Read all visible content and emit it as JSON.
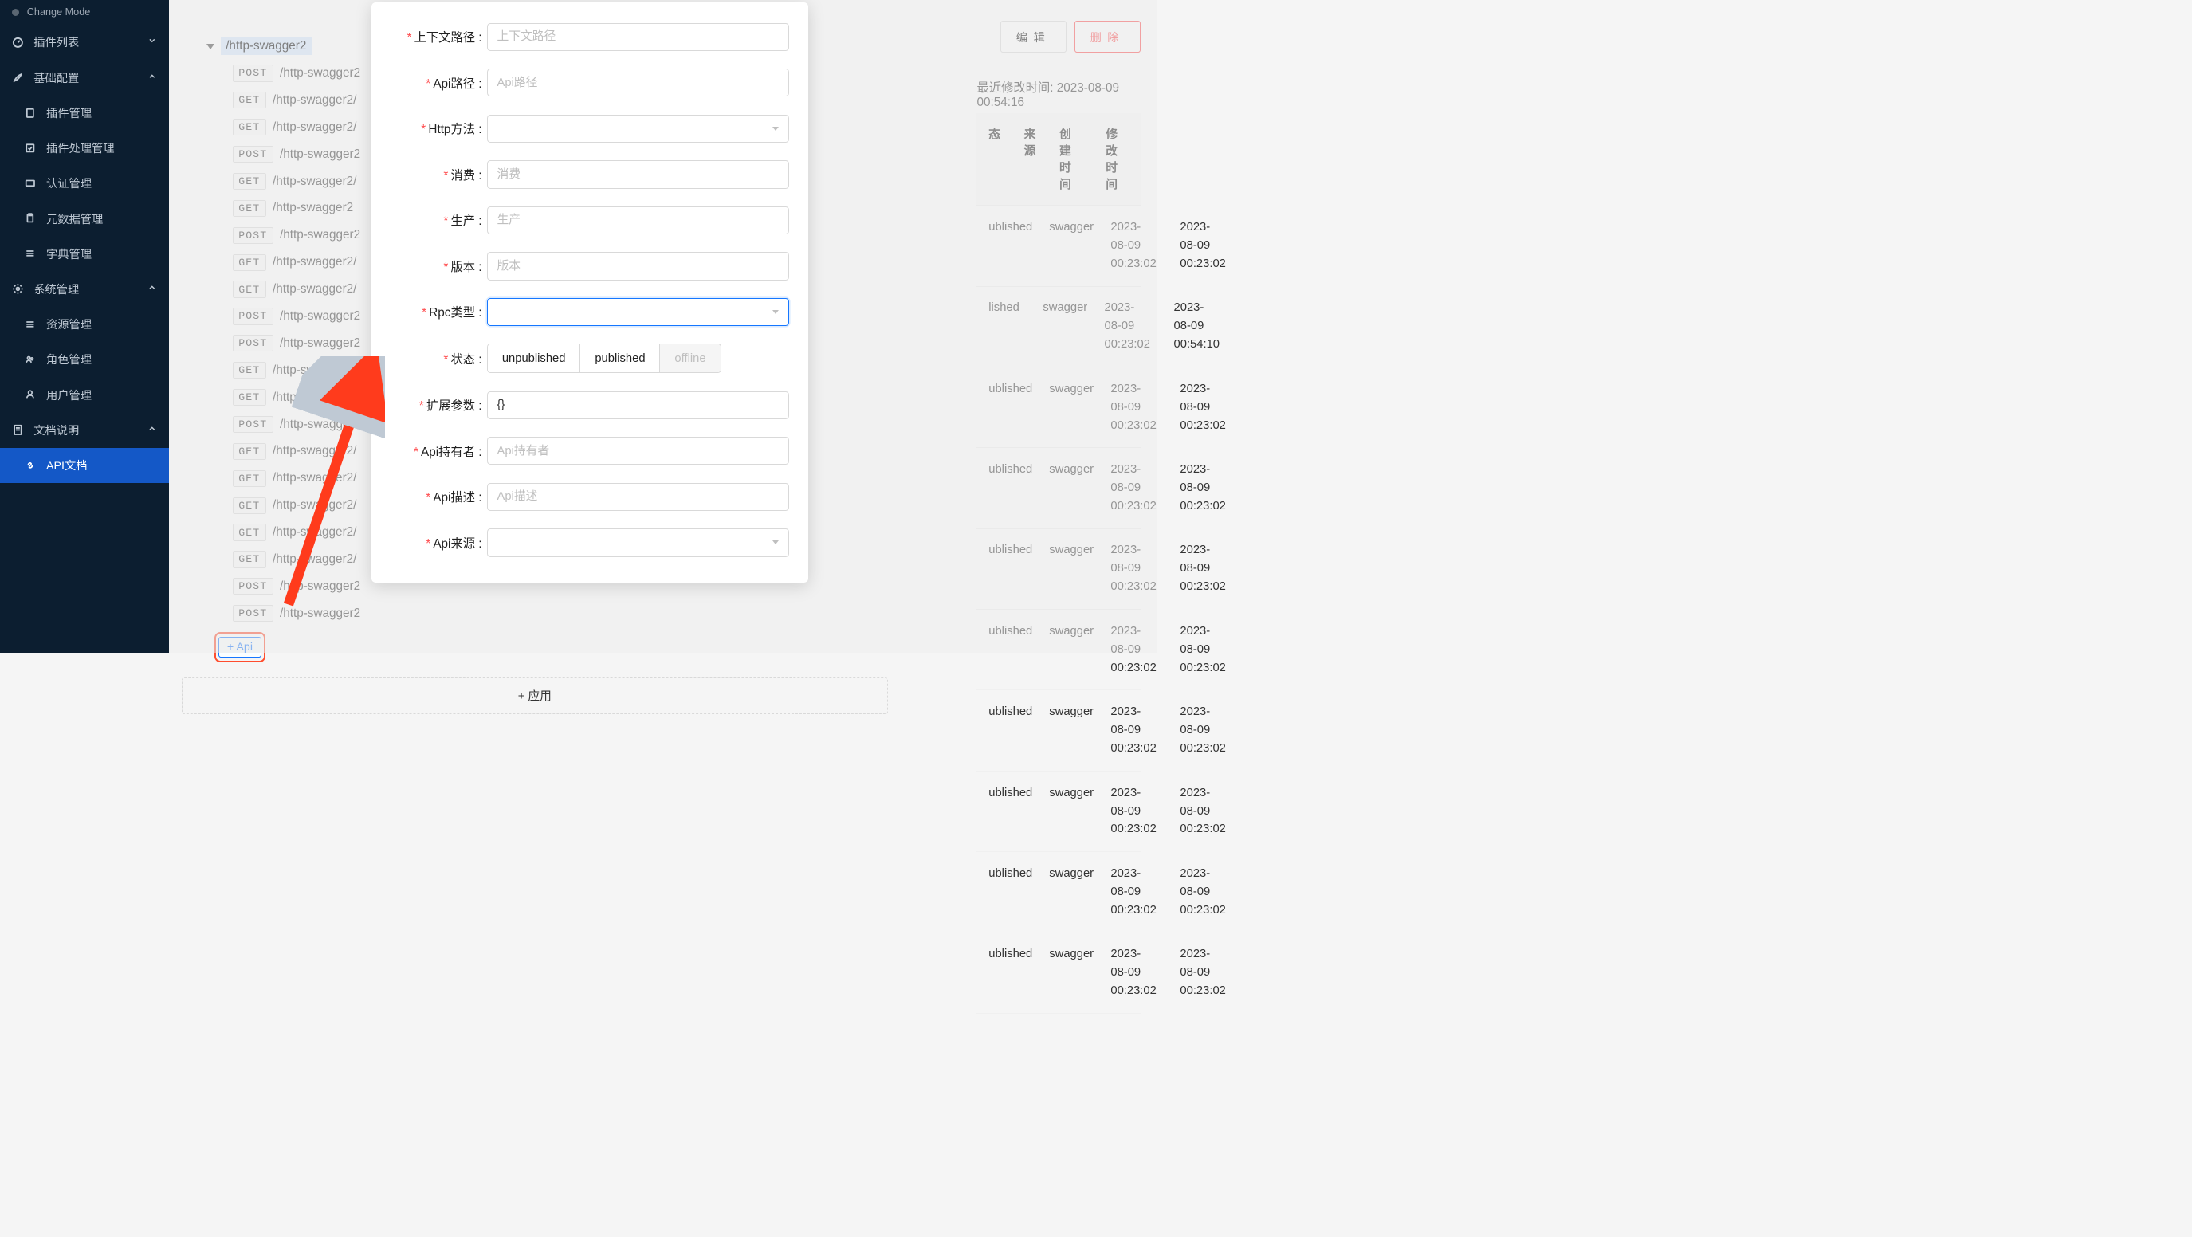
{
  "sidebar": {
    "mode_label": "Change Mode",
    "groups": {
      "plugin_list": "插件列表",
      "base_config": "基础配置",
      "system": "系统管理",
      "docs": "文档说明"
    },
    "items": {
      "plugin_manage": "插件管理",
      "plugin_process": "插件处理管理",
      "auth": "认证管理",
      "meta": "元数据管理",
      "dict": "字典管理",
      "resource": "资源管理",
      "role": "角色管理",
      "user": "用户管理",
      "api_doc": "API文档"
    }
  },
  "actions": {
    "edit": "编辑",
    "delete": "删除"
  },
  "tree": {
    "root": "/http-swagger2",
    "items": [
      {
        "method": "POST",
        "path": "/http-swagger2"
      },
      {
        "method": "GET",
        "path": "/http-swagger2/"
      },
      {
        "method": "GET",
        "path": "/http-swagger2/"
      },
      {
        "method": "POST",
        "path": "/http-swagger2"
      },
      {
        "method": "GET",
        "path": "/http-swagger2/"
      },
      {
        "method": "GET",
        "path": "/http-swagger2"
      },
      {
        "method": "POST",
        "path": "/http-swagger2"
      },
      {
        "method": "GET",
        "path": "/http-swagger2/"
      },
      {
        "method": "GET",
        "path": "/http-swagger2/"
      },
      {
        "method": "POST",
        "path": "/http-swagger2"
      },
      {
        "method": "POST",
        "path": "/http-swagger2"
      },
      {
        "method": "GET",
        "path": "/http-swagger2/"
      },
      {
        "method": "GET",
        "path": "/http-swagger2/"
      },
      {
        "method": "POST",
        "path": "/http-swagger2"
      },
      {
        "method": "GET",
        "path": "/http-swagger2/"
      },
      {
        "method": "GET",
        "path": "/http-swagger2/"
      },
      {
        "method": "GET",
        "path": "/http-swagger2/"
      },
      {
        "method": "GET",
        "path": "/http-swagger2/"
      },
      {
        "method": "GET",
        "path": "/http-swagger2/"
      },
      {
        "method": "POST",
        "path": "/http-swagger2"
      },
      {
        "method": "POST",
        "path": "/http-swagger2"
      }
    ],
    "add_api": "+ Api",
    "add_app": "+ 应用"
  },
  "meta": {
    "time_label": "最近修改时间: 2023-08-09 00:54:16"
  },
  "table": {
    "headers": {
      "status": "态",
      "source": "来源",
      "created": "创建时间",
      "modified": "修改时间"
    },
    "rows": [
      {
        "status": "ublished",
        "source": "swagger",
        "created": "2023-08-09 00:23:02",
        "modified": "2023-08-09 00:23:02"
      },
      {
        "status": "lished",
        "source": "swagger",
        "created": "2023-08-09 00:23:02",
        "modified": "2023-08-09 00:54:10"
      },
      {
        "status": "ublished",
        "source": "swagger",
        "created": "2023-08-09 00:23:02",
        "modified": "2023-08-09 00:23:02"
      },
      {
        "status": "ublished",
        "source": "swagger",
        "created": "2023-08-09 00:23:02",
        "modified": "2023-08-09 00:23:02"
      },
      {
        "status": "ublished",
        "source": "swagger",
        "created": "2023-08-09 00:23:02",
        "modified": "2023-08-09 00:23:02"
      },
      {
        "status": "ublished",
        "source": "swagger",
        "created": "2023-08-09 00:23:02",
        "modified": "2023-08-09 00:23:02"
      },
      {
        "status": "ublished",
        "source": "swagger",
        "created": "2023-08-09 00:23:02",
        "modified": "2023-08-09 00:23:02"
      },
      {
        "status": "ublished",
        "source": "swagger",
        "created": "2023-08-09 00:23:02",
        "modified": "2023-08-09 00:23:02"
      },
      {
        "status": "ublished",
        "source": "swagger",
        "created": "2023-08-09 00:23:02",
        "modified": "2023-08-09 00:23:02"
      },
      {
        "status": "ublished",
        "source": "swagger",
        "created": "2023-08-09 00:23:02",
        "modified": "2023-08-09 00:23:02"
      }
    ]
  },
  "form": {
    "labels": {
      "context_path": "上下文路径 :",
      "api_path": "Api路径 :",
      "http_method": "Http方法 :",
      "consume": "消费 :",
      "produce": "生产 :",
      "version": "版本 :",
      "rpc_type": "Rpc类型 :",
      "status": "状态 :",
      "ext": "扩展参数 :",
      "owner": "Api持有者 :",
      "desc": "Api描述 :",
      "source": "Api来源 :"
    },
    "placeholders": {
      "context_path": "上下文路径",
      "api_path": "Api路径",
      "consume": "消费",
      "produce": "生产",
      "version": "版本",
      "owner": "Api持有者",
      "desc": "Api描述"
    },
    "status_opts": {
      "unpublished": "unpublished",
      "published": "published",
      "offline": "offline"
    },
    "ext_value": "{}"
  }
}
